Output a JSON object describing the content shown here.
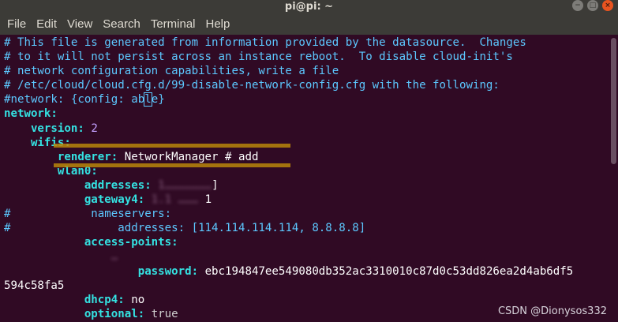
{
  "window": {
    "title": "pi@pi: ~",
    "controls": {
      "minimize": "−",
      "maximize": "□",
      "close": "×"
    }
  },
  "menu": [
    "File",
    "Edit",
    "View",
    "Search",
    "Terminal",
    "Help"
  ],
  "lines": {
    "l1": "# This file is generated from information provided by the datasource.  Changes",
    "l2": "# to it will not persist across an instance reboot.  To disable cloud-init's",
    "l3": "# network configuration capabilities, write a file",
    "l4": "# /etc/cloud/cloud.cfg.d/99-disable-network-config.cfg with the following:",
    "l5a": "#network: {config: ab",
    "l5cur": "l",
    "l5b": "e}",
    "l6": "network:",
    "l7key": "    version:",
    "l7val": " 2",
    "l8": "    wifis:",
    "l9key": "        renderer:",
    "l9val": " NetworkManager # add",
    "l10": "        wlan0:",
    "l11key": "            addresses:",
    "l11blur": " 1…………………",
    "l11end": "]",
    "l12key": "            gateway4:",
    "l12blur": " 1.1 ………",
    "l12end": " 1",
    "l13": "#            nameservers:",
    "l14": "#                addresses: [114.114.114.114, 8.8.8.8]",
    "l15": "            access-points:",
    "l16blur": "                …",
    "l17key": "                    password:",
    "l17val": " ebc194847ee549080db352ac3310010c87d0c53dd826ea2d4ab6df5",
    "l18": "594c58fa5",
    "l19key": "            dhcp4:",
    "l19val": " no",
    "l20key": "            optional:",
    "l20val": " true"
  },
  "watermark": "CSDN @Dionysos332",
  "colors": {
    "background": "#300a24",
    "comment": "#5cc8ff",
    "key": "#34e2e2",
    "number": "#c4a0ff",
    "highlight": "#b8860b"
  }
}
